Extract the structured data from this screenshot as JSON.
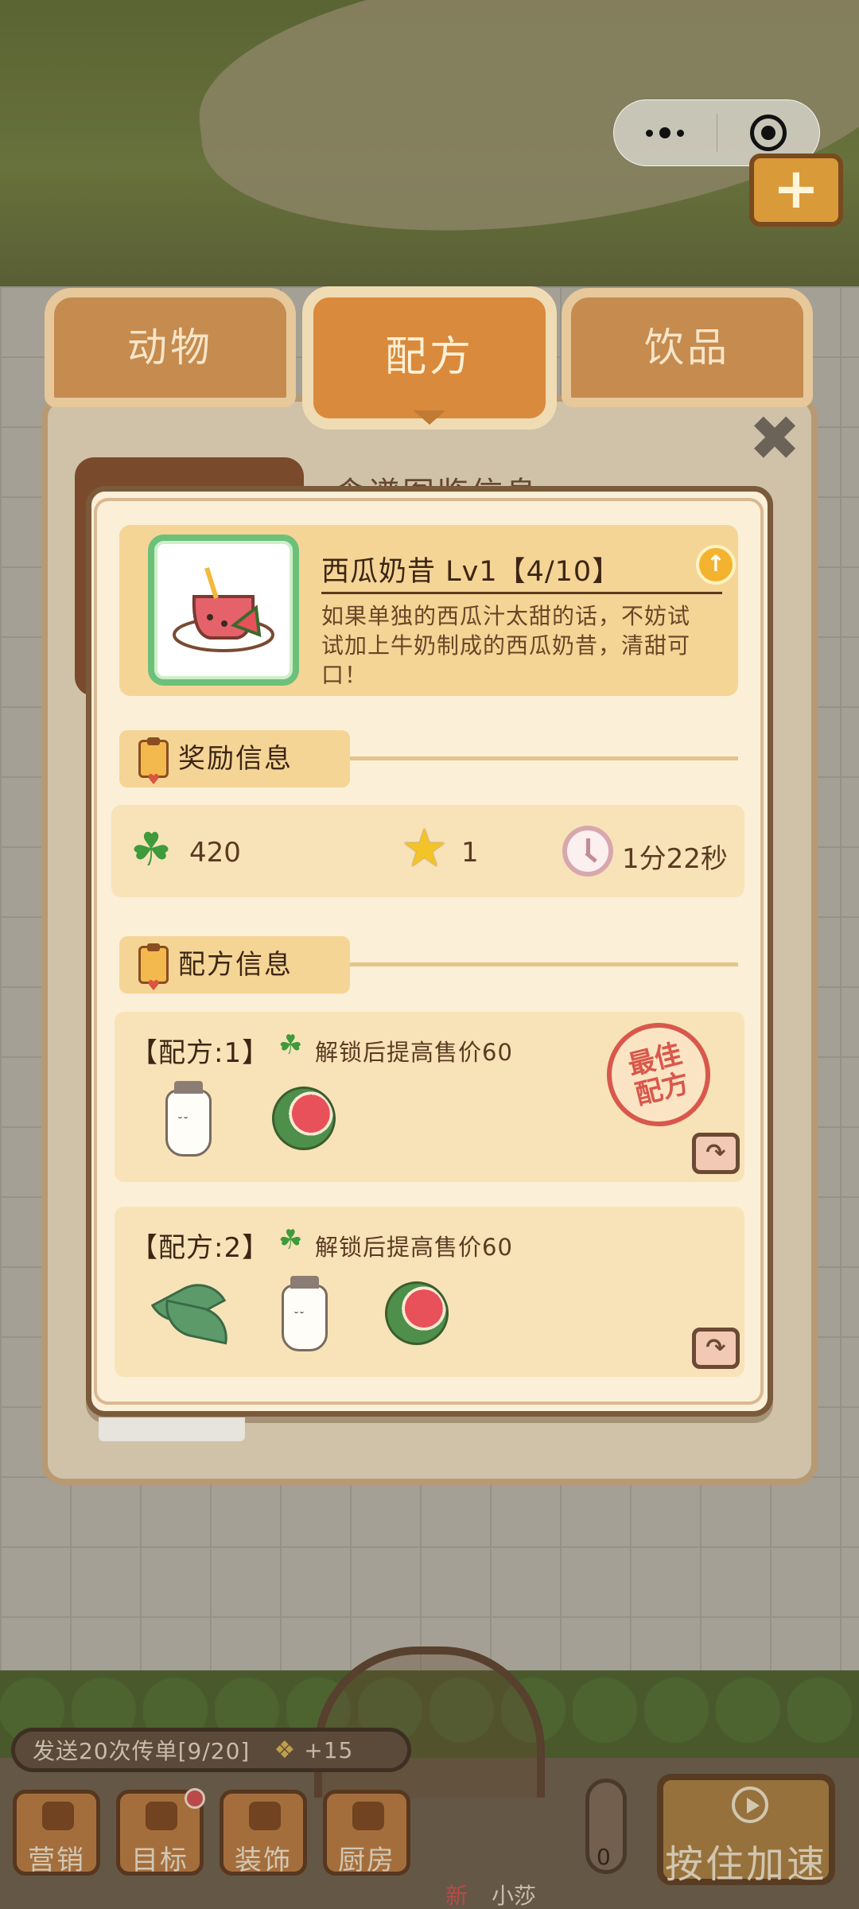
{
  "tabs": {
    "animals": "动物",
    "recipe": "配方",
    "drinks": "饮品"
  },
  "back_panel": {
    "title": "食谱图鉴信息"
  },
  "item": {
    "name": "西瓜奶昔 Lv1【4/10】",
    "description": "如果单独的西瓜汁太甜的话，不妨试试加上牛奶制成的西瓜奶昔，清甜可口！",
    "thumb_icon": "watermelon-smoothie-icon",
    "upgrade_icon": "arrow-up-icon"
  },
  "reward_section": {
    "title": "奖励信息",
    "clover": "420",
    "star": "1",
    "time": "1分22秒"
  },
  "recipe_section": {
    "title": "配方信息",
    "recipes": [
      {
        "label": "【配方:1】",
        "bonus": "解锁后提高售价60",
        "ingredients": [
          "milk-bottle-icon",
          "watermelon-icon"
        ],
        "stamp_line1": "最佳",
        "stamp_line2": "配方"
      },
      {
        "label": "【配方:2】",
        "bonus": "解锁后提高售价60",
        "ingredients": [
          "tea-leaf-icon",
          "milk-bottle-icon",
          "watermelon-icon"
        ]
      }
    ]
  },
  "hud": {
    "task": "发送20次传单[9/20]",
    "task_reward": "+15",
    "menu": {
      "marketing": "营销",
      "target": "目标",
      "decor": "装饰",
      "kitchen": "厨房"
    },
    "thermo_value": "0",
    "speed_button": "按住加速",
    "new_label": "新",
    "npc_name": "小莎"
  },
  "colors": {
    "accent": "#d98a3c",
    "dialog_bg": "#fbefd7",
    "card_bg": "#f5d596",
    "clover": "#3f9a3c",
    "stamp": "#d8584b"
  }
}
